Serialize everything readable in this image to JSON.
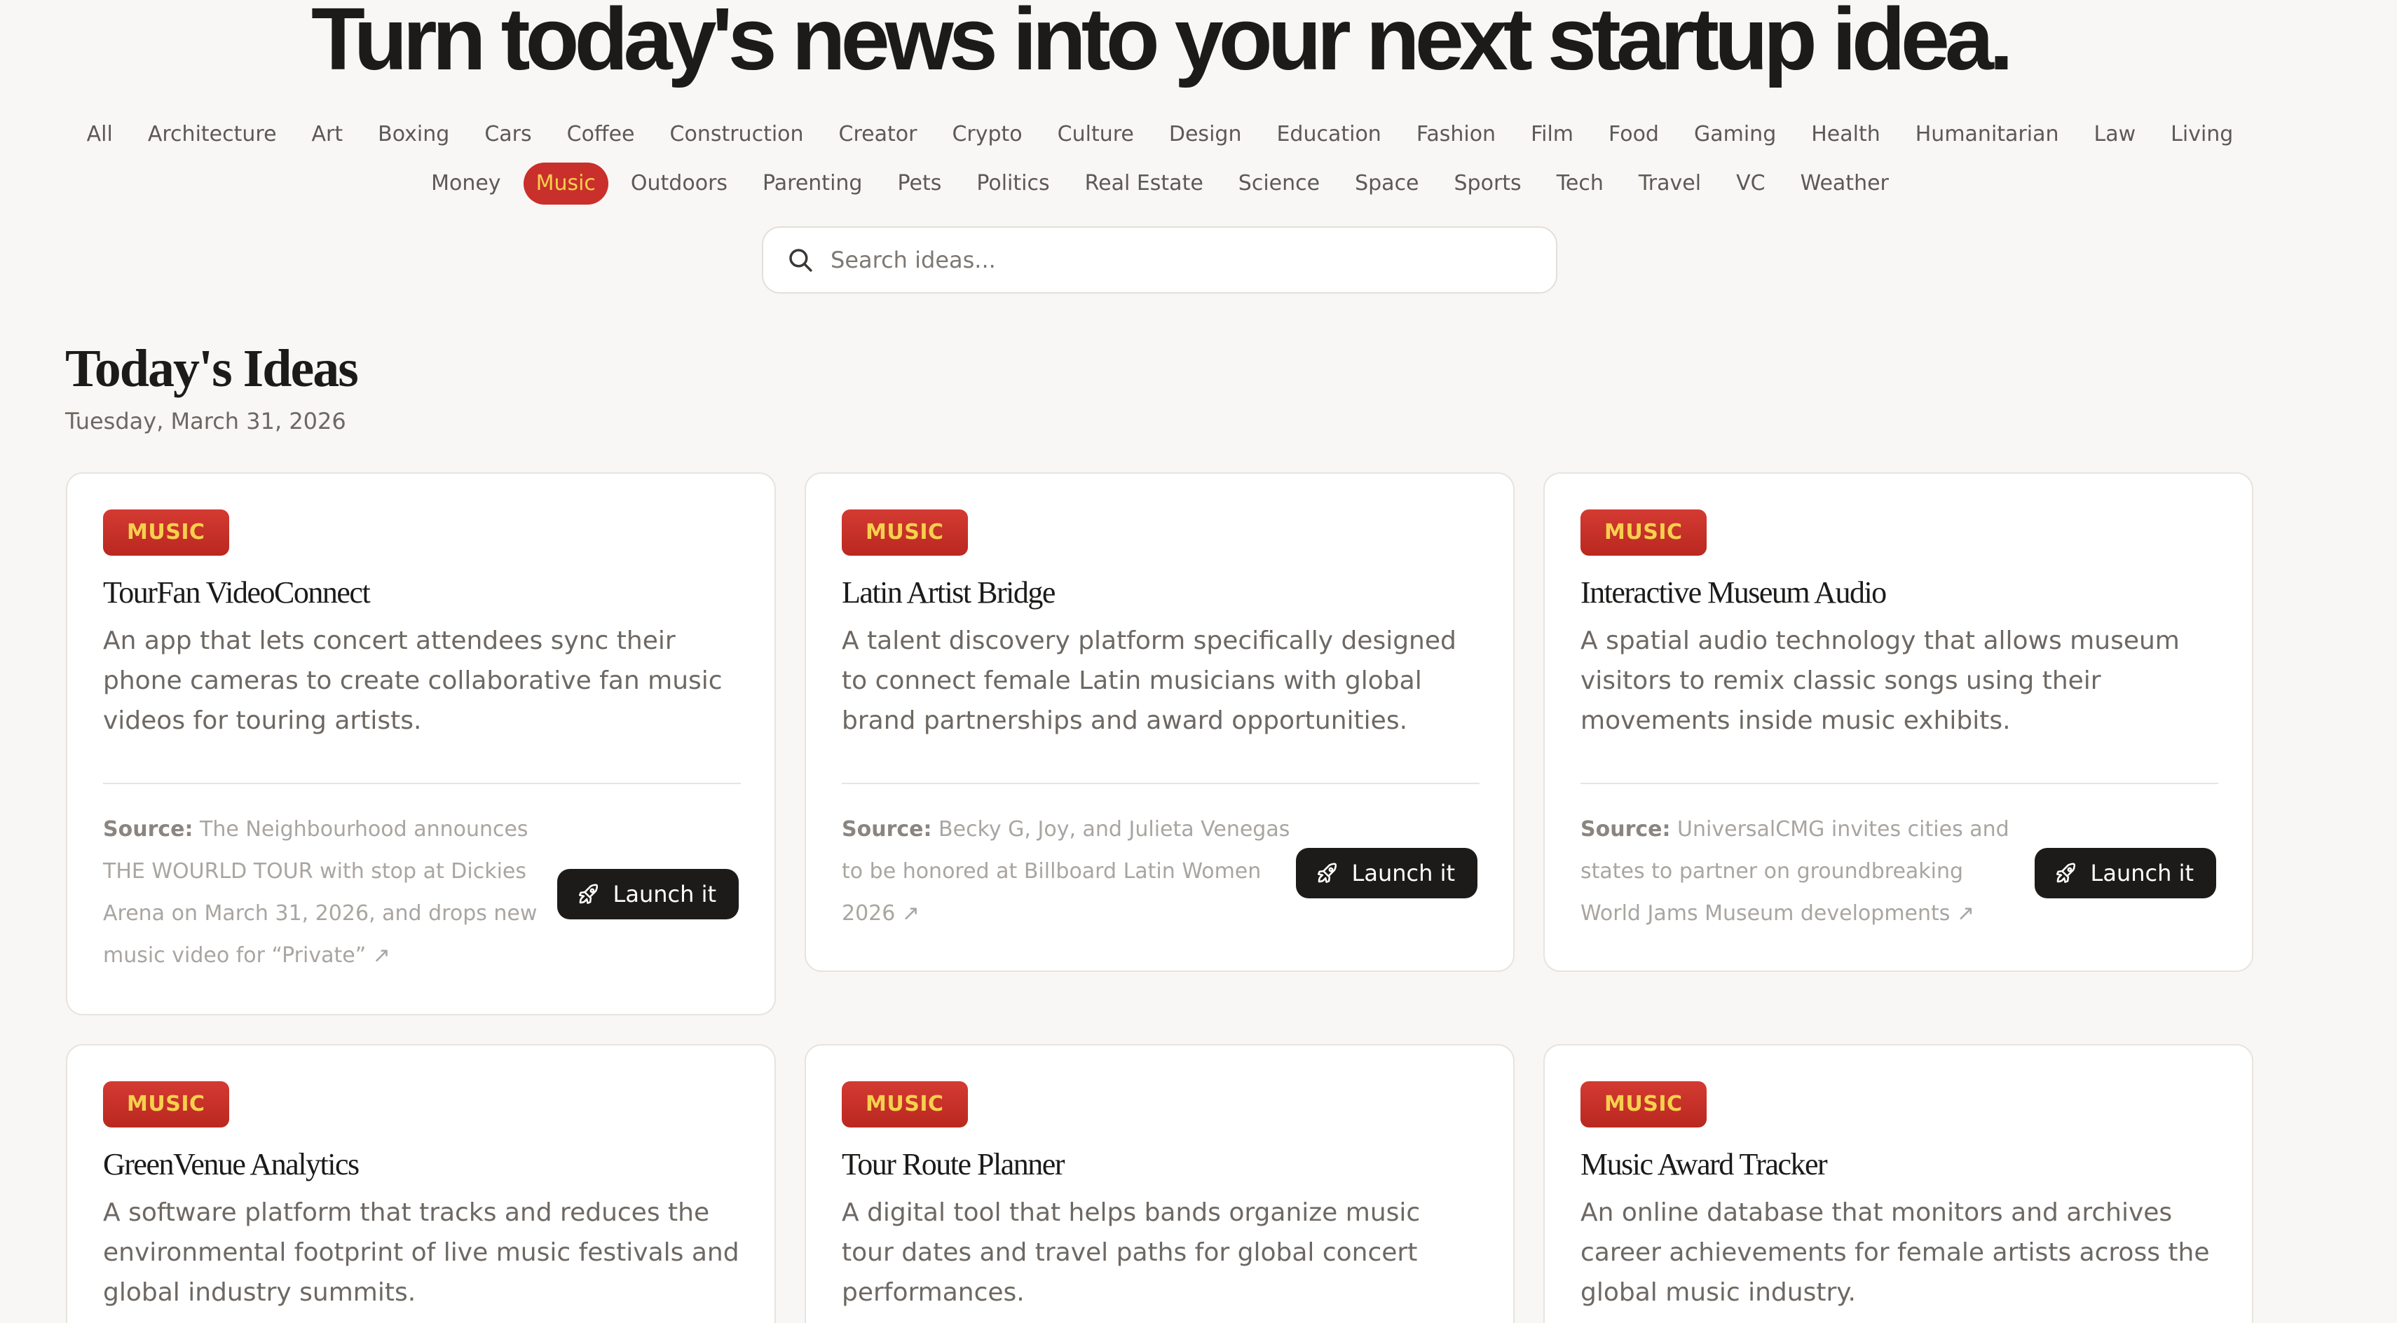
{
  "hero": {
    "title": "Turn today's news into your next startup idea."
  },
  "categories": {
    "row1": [
      "All",
      "Architecture",
      "Art",
      "Boxing",
      "Cars",
      "Coffee",
      "Construction",
      "Creator",
      "Crypto",
      "Culture",
      "Design",
      "Education",
      "Fashion",
      "Film",
      "Food",
      "Gaming",
      "Health",
      "Humanitarian",
      "Law",
      "Living"
    ],
    "row2": [
      "Money",
      "Music",
      "Outdoors",
      "Parenting",
      "Pets",
      "Politics",
      "Real Estate",
      "Science",
      "Space",
      "Sports",
      "Tech",
      "Travel",
      "VC",
      "Weather"
    ],
    "active": "Music"
  },
  "search": {
    "placeholder": "Search ideas..."
  },
  "section": {
    "title": "Today's Ideas",
    "date": "Tuesday, March 31, 2026"
  },
  "cards": [
    {
      "badge": "MUSIC",
      "title": "TourFan VideoConnect",
      "description": "An app that lets concert attendees sync their phone cameras to create collaborative fan music videos for touring artists.",
      "source_label": "Source:",
      "source_text": "The Neighbourhood announces THE WOURLD TOUR with stop at Dickies Arena on March 31, 2026, and drops new music video for “Private” ↗",
      "button": "Launch it"
    },
    {
      "badge": "MUSIC",
      "title": "Latin Artist Bridge",
      "description": "A talent discovery platform specifically designed to connect female Latin musicians with global brand partnerships and award opportunities.",
      "source_label": "Source:",
      "source_text": "Becky G, Joy, and Julieta Venegas to be honored at Billboard Latin Women 2026 ↗",
      "button": "Launch it"
    },
    {
      "badge": "MUSIC",
      "title": "Interactive Museum Audio",
      "description": "A spatial audio technology that allows museum visitors to remix classic songs using their movements inside music exhibits.",
      "source_label": "Source:",
      "source_text": "UniversalCMG invites cities and states to partner on groundbreaking World Jams Museum developments ↗",
      "button": "Launch it"
    },
    {
      "badge": "MUSIC",
      "title": "GreenVenue Analytics",
      "description": "A software platform that tracks and reduces the environmental footprint of live music festivals and global industry summits."
    },
    {
      "badge": "MUSIC",
      "title": "Tour Route Planner",
      "description": "A digital tool that helps bands organize music tour dates and travel paths for global concert performances."
    },
    {
      "badge": "MUSIC",
      "title": "Music Award Tracker",
      "description": "An online database that monitors and archives career achievements for female artists across the global music industry."
    }
  ]
}
